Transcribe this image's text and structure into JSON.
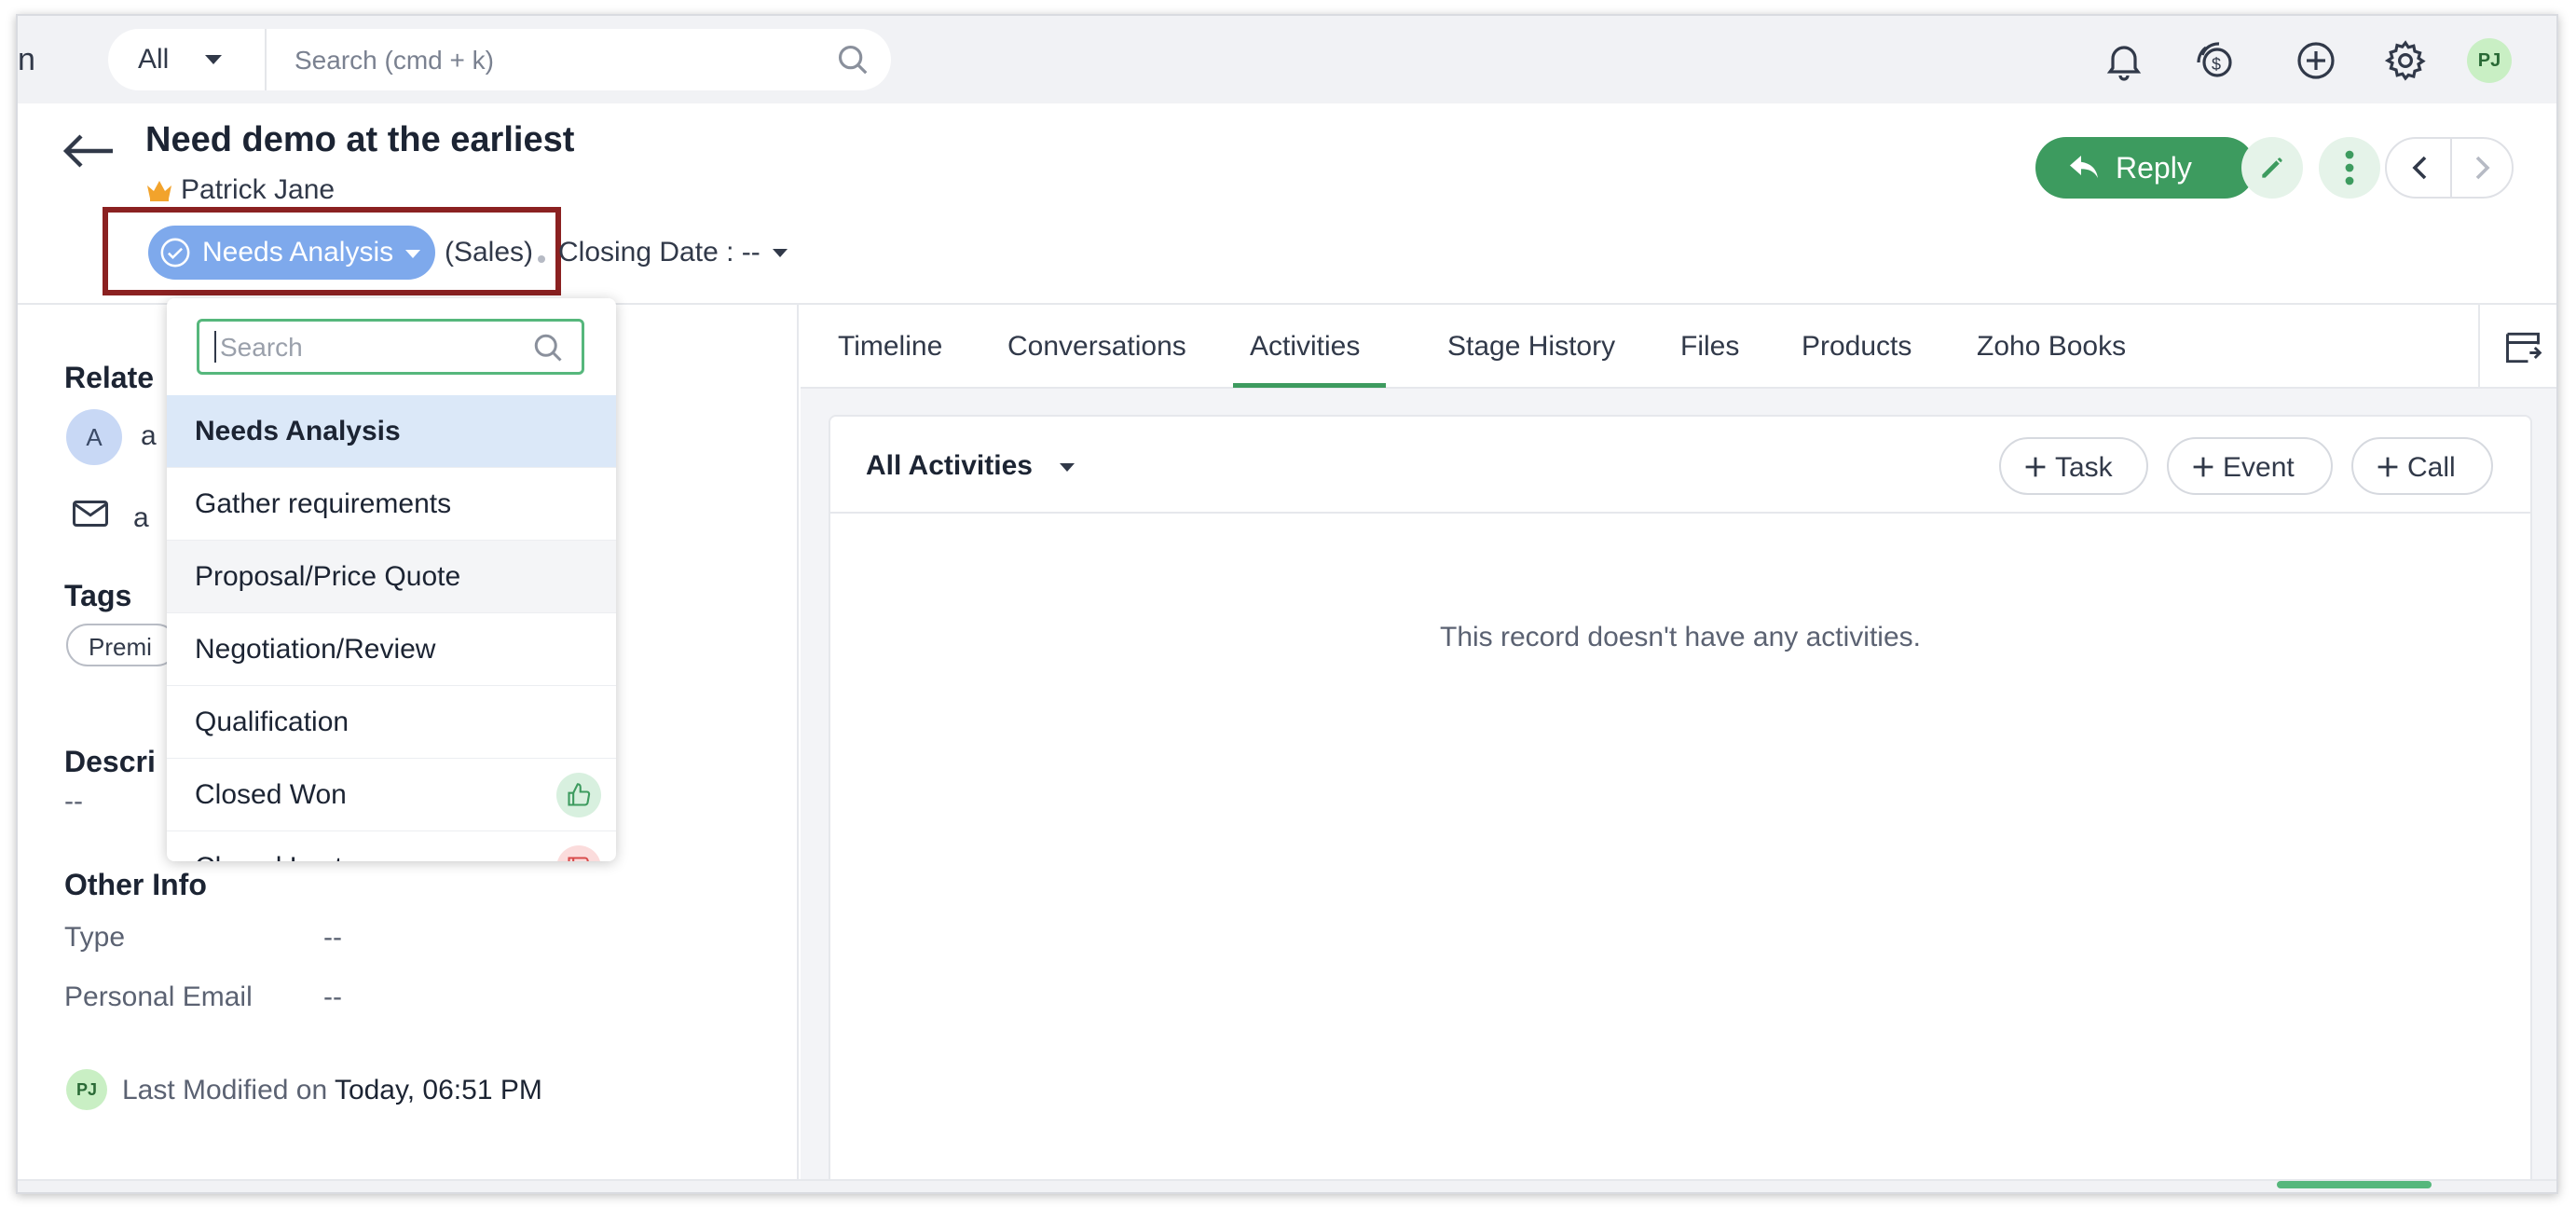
{
  "topbar": {
    "brand_fragment": "n",
    "scope": "All",
    "search_placeholder": "Search (cmd + k)",
    "avatar_initials": "PJ"
  },
  "record": {
    "title": "Need demo at the earliest",
    "owner": "Patrick Jane",
    "stage": "Needs Analysis",
    "pipeline": "(Sales)",
    "closing_date": "Closing Date : --"
  },
  "actions": {
    "reply_label": "Reply"
  },
  "left": {
    "related_heading": "Relate",
    "contact_initial": "A",
    "contact_fragment": "a",
    "email_fragment": "a",
    "tags_heading": "Tags",
    "tag": "Premi",
    "description_heading": "Descri",
    "description_value": "--",
    "other_info_heading": "Other Info",
    "fields": [
      {
        "label": "Type",
        "value": "--"
      },
      {
        "label": "Personal Email",
        "value": "--"
      }
    ],
    "modified_avatar": "PJ",
    "modified_label": "Last Modified on",
    "modified_value": "Today, 06:51 PM"
  },
  "tabs": [
    "Timeline",
    "Conversations",
    "Activities",
    "Stage History",
    "Files",
    "Products",
    "Zoho Books"
  ],
  "activities": {
    "filter": "All Activities",
    "buttons": [
      "Task",
      "Event",
      "Call"
    ],
    "empty_message": "This record doesn't have any activities."
  },
  "stage_dropdown": {
    "search_placeholder": "Search",
    "options": [
      "Needs Analysis",
      "Gather requirements",
      "Proposal/Price Quote",
      "Negotiation/Review",
      "Qualification",
      "Closed Won",
      "Closed Lost"
    ]
  },
  "colors": {
    "accent_green": "#3d9b5f",
    "stage_blue": "#7ea9ec",
    "highlight_red": "#8b2121"
  }
}
